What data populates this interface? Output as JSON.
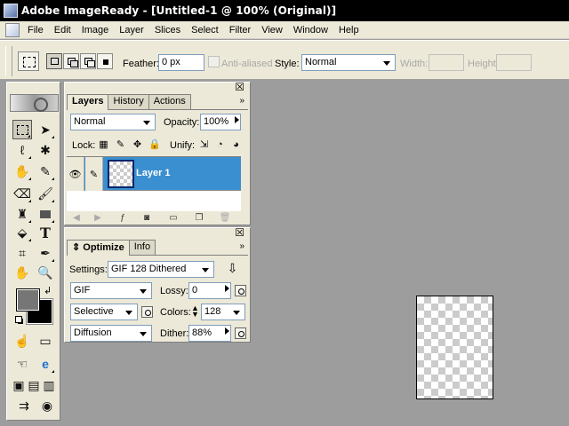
{
  "app": {
    "title": "Adobe ImageReady - [Untitled-1 @ 100% (Original)]"
  },
  "menu": [
    "File",
    "Edit",
    "Image",
    "Layer",
    "Slices",
    "Select",
    "Filter",
    "View",
    "Window",
    "Help"
  ],
  "options": {
    "feather_label": "Feather:",
    "feather_value": "0 px",
    "anti_aliased_label": "Anti-aliased",
    "style_label": "Style:",
    "style_value": "Normal",
    "width_label": "Width:",
    "height_label": "Height:"
  },
  "layers_panel": {
    "tabs": [
      "Layers",
      "History",
      "Actions"
    ],
    "blend_mode": "Normal",
    "opacity_label": "Opacity:",
    "opacity_value": "100%",
    "lock_label": "Lock:",
    "unify_label": "Unify:",
    "layers": [
      {
        "name": "Layer 1"
      }
    ]
  },
  "optimize_panel": {
    "tabs": [
      "Optimize",
      "Info"
    ],
    "settings_label": "Settings:",
    "settings_value": "GIF 128 Dithered",
    "format_value": "GIF",
    "lossy_label": "Lossy:",
    "lossy_value": "0",
    "palette_value": "Selective",
    "colors_label": "Colors:",
    "colors_value": "128",
    "dither_method": "Diffusion",
    "dither_label": "Dither:",
    "dither_value": "88%"
  },
  "colors": {
    "foreground": "#767676",
    "background": "#000000",
    "layer_selected": "#3a8fd0",
    "workspace": "#9d9d9d"
  }
}
